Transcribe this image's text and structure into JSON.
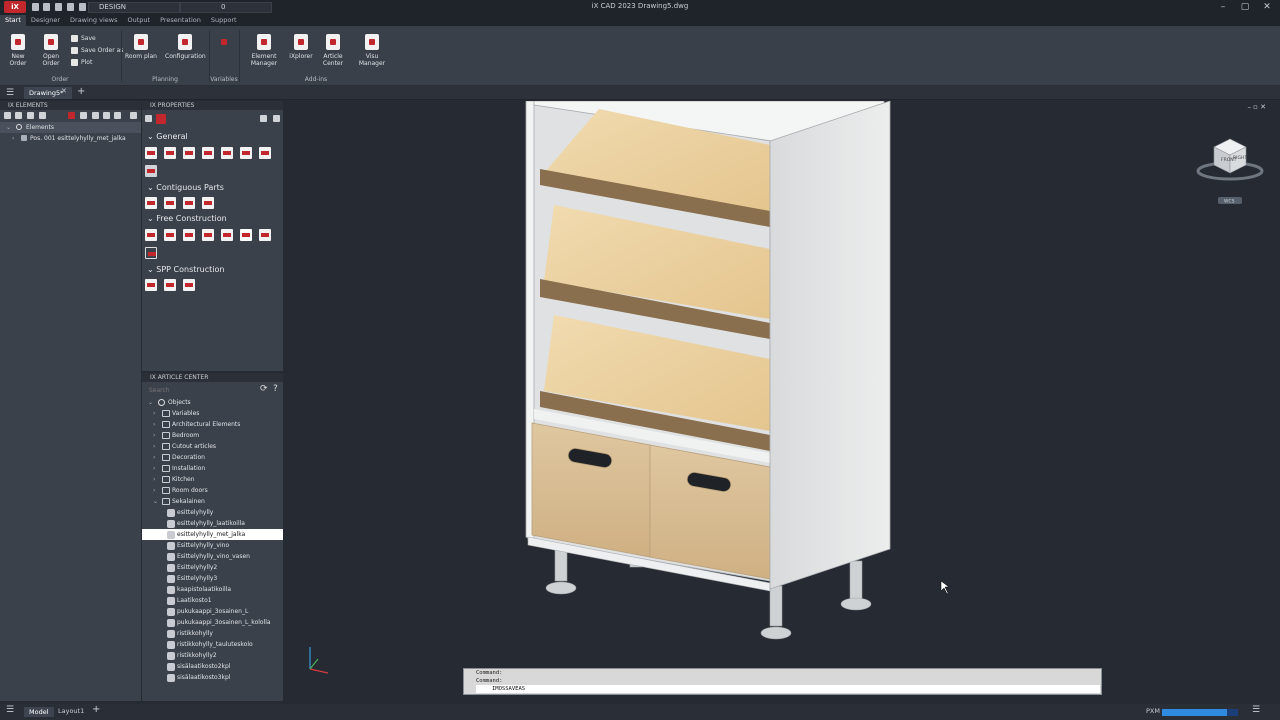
{
  "app": {
    "logo": "iX",
    "workspace": "DESIGN",
    "layer": "0",
    "window_title": "iX CAD 2023    Drawing5.dwg",
    "window_controls": [
      "–",
      "▢",
      "✕"
    ]
  },
  "menu_tabs": [
    "Start",
    "Designer",
    "Drawing views",
    "Output",
    "Presentation",
    "Support"
  ],
  "ribbon": {
    "buttons": [
      "New Order",
      "Open Order",
      "Room plan",
      "Configuration",
      "Element Manager",
      "iXplorer",
      "Article Center",
      "Visu Manager"
    ],
    "small": [
      "Save",
      "Save Order as",
      "Plot"
    ],
    "groups": [
      "Order",
      "Planning",
      "Variables",
      "Add-ins"
    ]
  },
  "doc_tab": {
    "name": "Drawing5*",
    "close": "✕",
    "new": "+"
  },
  "elements_panel": {
    "title": "IX ELEMENTS",
    "root": "Elements",
    "child": "Pos. 001 esittelyhylly_met_jalka"
  },
  "properties_panel": {
    "title": "IX PROPERTIES",
    "sections": [
      "General",
      "Contiguous Parts",
      "Free Construction",
      "SPP Construction"
    ]
  },
  "article_panel": {
    "title": "IX ARTICLE CENTER",
    "search_placeholder": "Search",
    "root": "Objects",
    "folders": [
      "Variables",
      "Architectural Elements",
      "Bedroom",
      "Cutout articles",
      "Decoration",
      "Installation",
      "Kitchen",
      "Room doors",
      "Sekalainen"
    ],
    "items": [
      "esittelyhylly",
      "esittelyhylly_laatikoilla",
      "esittelyhylly_met_jalka",
      "Esittelyhylly_vino",
      "Esittelyhylly_vino_vasen",
      "Esittelyhylly2",
      "Esittelyhylly3",
      "kaapistolaatikoilla",
      "Laatikosto1",
      "pukukaappi_3osainen_L",
      "pukukaappi_3osainen_L_kololla",
      "ristikkohylly",
      "ristikkohylly_tauluteskolo",
      "ristikkohylly2",
      "sisälaatikosto2kpl",
      "sisälaatikosto3kpl"
    ],
    "selected_index": 2
  },
  "viewcube": {
    "face_left": "FRONT",
    "face_right": "RIGHT",
    "wcs": "WCS"
  },
  "command": {
    "history": [
      "Command:",
      "Command:"
    ],
    "current": "IMOSSAVEAS"
  },
  "status": {
    "model": "Model",
    "layout": "Layout1",
    "add": "+",
    "mode": "PXM",
    "progress": 0.86
  },
  "colors": {
    "accent": "#c2272d",
    "background": "#252a33",
    "panel": "#3b414b",
    "wood": "#e9cf9d"
  }
}
